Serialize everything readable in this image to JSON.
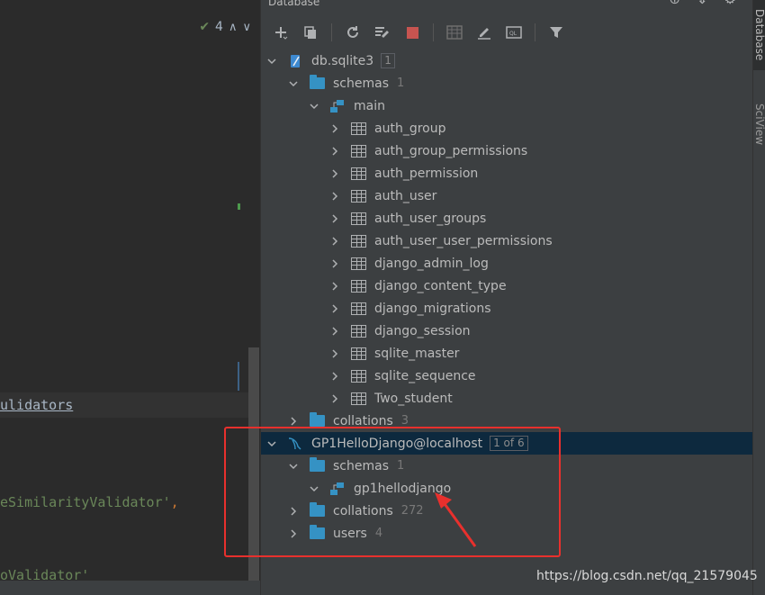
{
  "editor": {
    "inspection_count": "4",
    "code_lines": {
      "validators": "ulidators",
      "similarity": "eSimilarityValidator'",
      "similarity_comma": ",",
      "validator2": "oValidator'"
    }
  },
  "db_panel": {
    "title": "Database",
    "tree": {
      "sqlite": {
        "name": "db.sqlite3",
        "badge": "1",
        "schemas_label": "schemas",
        "schemas_count": "1",
        "main_label": "main",
        "tables": [
          "auth_group",
          "auth_group_permissions",
          "auth_permission",
          "auth_user",
          "auth_user_groups",
          "auth_user_user_permissions",
          "django_admin_log",
          "django_content_type",
          "django_migrations",
          "django_session",
          "sqlite_master",
          "sqlite_sequence",
          "Two_student"
        ],
        "collations_label": "collations",
        "collations_count": "3"
      },
      "mysql": {
        "name": "GP1HelloDjango@localhost",
        "badge": "1 of 6",
        "schemas_label": "schemas",
        "schemas_count": "1",
        "schema_name": "gp1hellodjango",
        "collations_label": "collations",
        "collations_count": "272",
        "users_label": "users",
        "users_count": "4"
      }
    }
  },
  "side_tabs": {
    "database": "Database",
    "sciview": "SciView"
  },
  "watermark": "https://blog.csdn.net/qq_21579045",
  "colors": {
    "folder": "#3592c4",
    "selected_row": "#0d293e",
    "annotation": "#e8302d"
  }
}
